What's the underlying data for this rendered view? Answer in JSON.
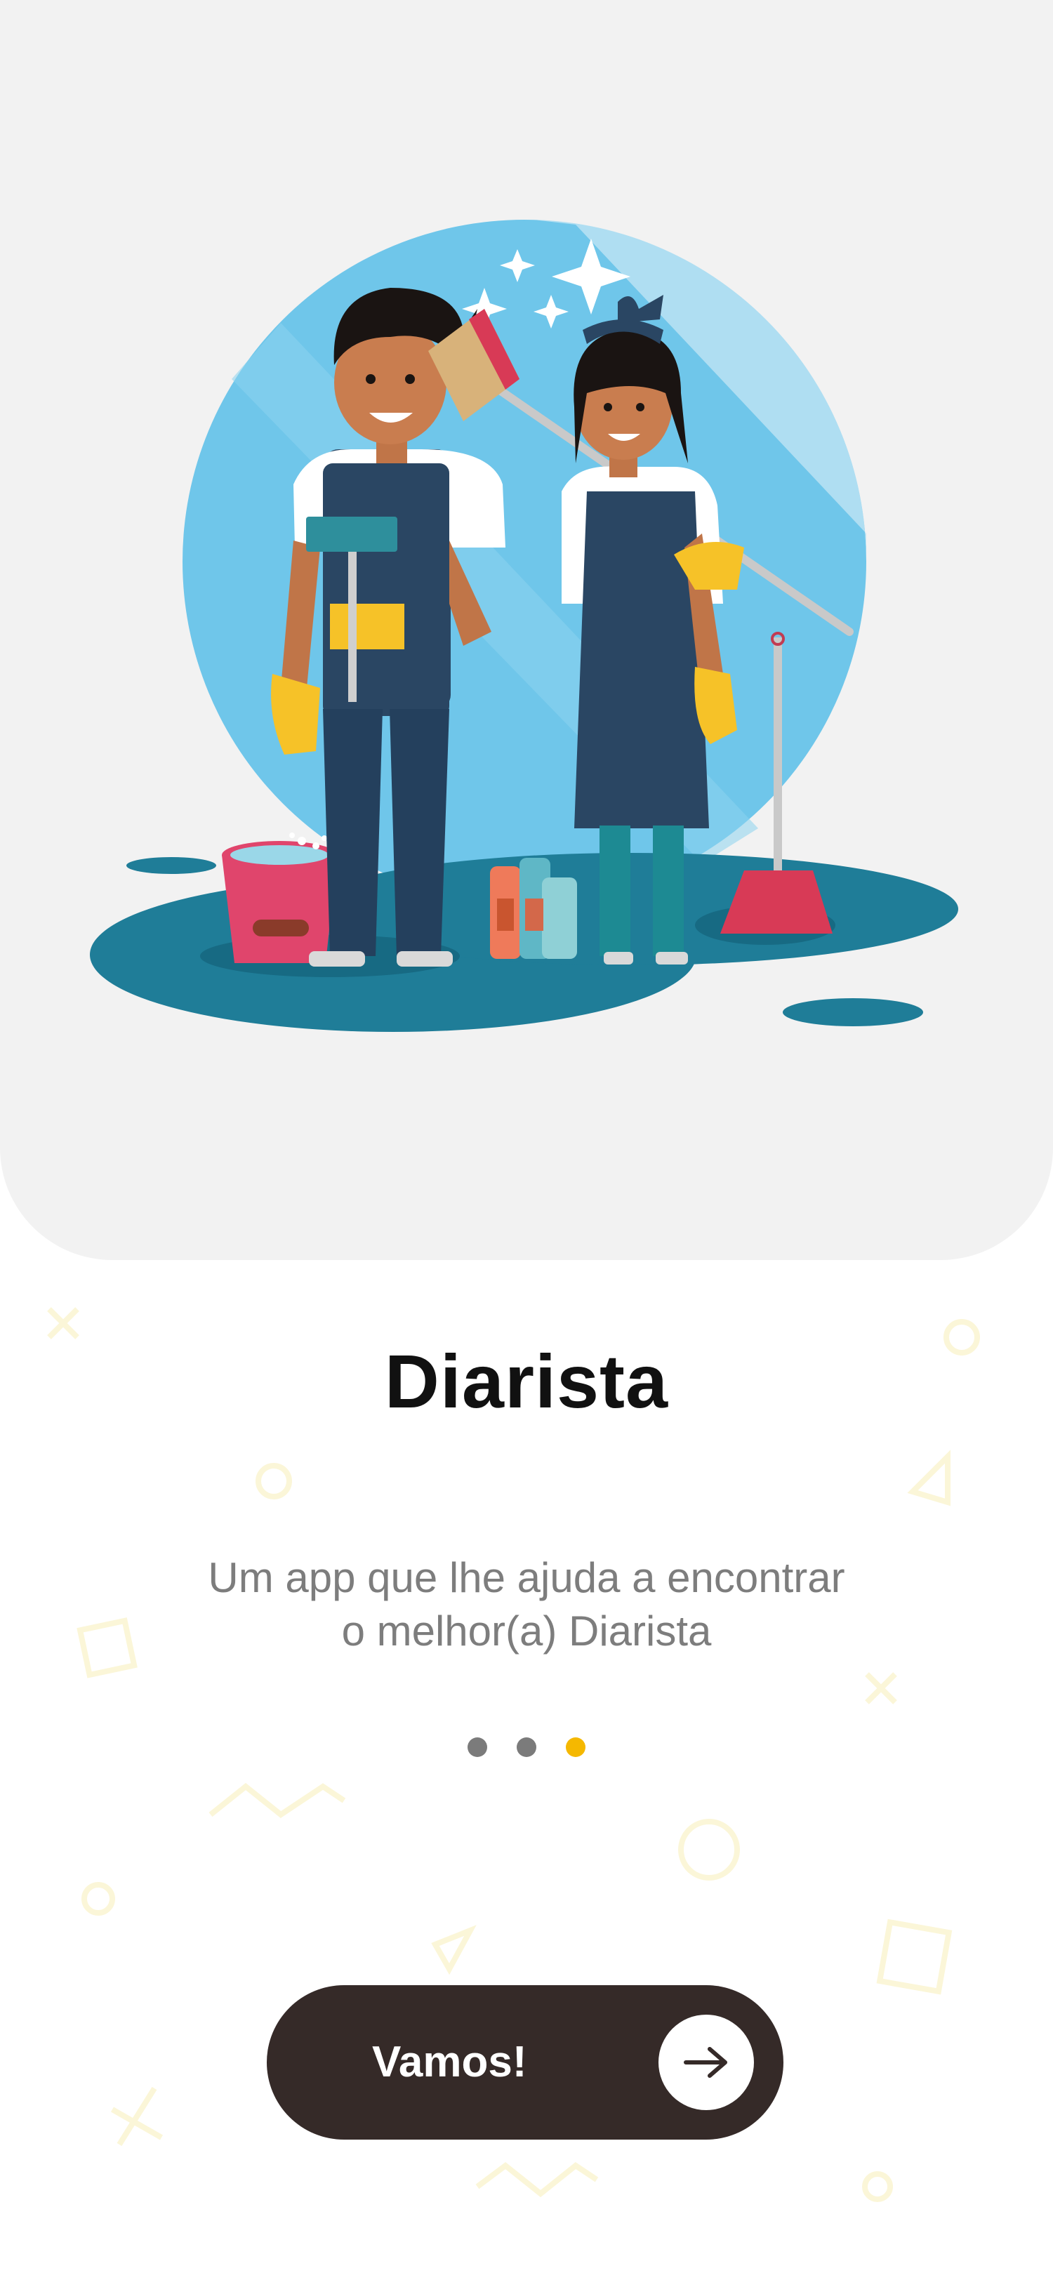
{
  "onboarding": {
    "title": "Diarista",
    "subtitle_line1": "Um app que lhe ajuda a encontrar",
    "subtitle_line2": "o melhor(a) Diarista",
    "pagination": {
      "total": 3,
      "current": 3
    },
    "cta": {
      "label": "Vamos!",
      "icon": "arrow-right-icon"
    }
  },
  "illustration": {
    "name": "cleaning-staff-illustration"
  },
  "colors": {
    "accent": "#f5b800",
    "button_bg": "#352a28",
    "hero_bg": "#f2f2f2",
    "dot_inactive": "#7b7b7b",
    "subtitle": "#7d7d7d"
  }
}
